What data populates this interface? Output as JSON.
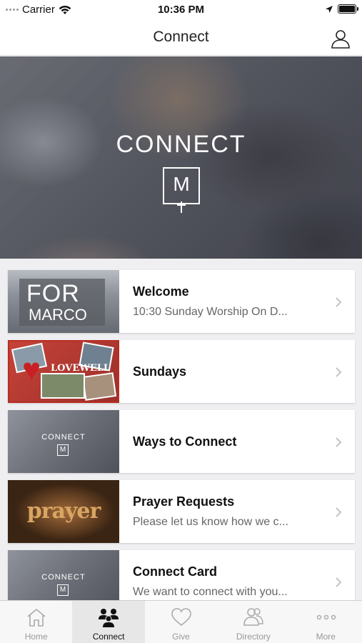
{
  "status_bar": {
    "carrier": "Carrier",
    "time": "10:36 PM"
  },
  "nav": {
    "title": "Connect"
  },
  "hero": {
    "title": "CONNECT",
    "logo_letter": "M"
  },
  "items": [
    {
      "title": "Welcome",
      "subtitle": "10:30 Sunday Worship On D...",
      "thumb": {
        "line1": "FOR",
        "line2": "MARCO"
      }
    },
    {
      "title": "Sundays",
      "subtitle": "",
      "thumb": {
        "word": "LOVEWELL"
      }
    },
    {
      "title": "Ways to Connect",
      "subtitle": "",
      "thumb": {
        "word": "CONNECT",
        "letter": "M"
      }
    },
    {
      "title": "Prayer Requests",
      "subtitle": "Please let us know how we c...",
      "thumb": {
        "word": "prayer"
      }
    },
    {
      "title": "Connect Card",
      "subtitle": "We want to connect with you...",
      "thumb": {
        "word": "CONNECT",
        "letter": "M"
      }
    }
  ],
  "tabs": [
    {
      "label": "Home",
      "icon": "home-icon"
    },
    {
      "label": "Connect",
      "icon": "connect-icon",
      "active": true
    },
    {
      "label": "Give",
      "icon": "heart-icon"
    },
    {
      "label": "Directory",
      "icon": "directory-icon"
    },
    {
      "label": "More",
      "icon": "more-icon"
    }
  ],
  "colors": {
    "active_tab": "#111111",
    "inactive_tab": "#999999",
    "background": "#efeff1"
  }
}
